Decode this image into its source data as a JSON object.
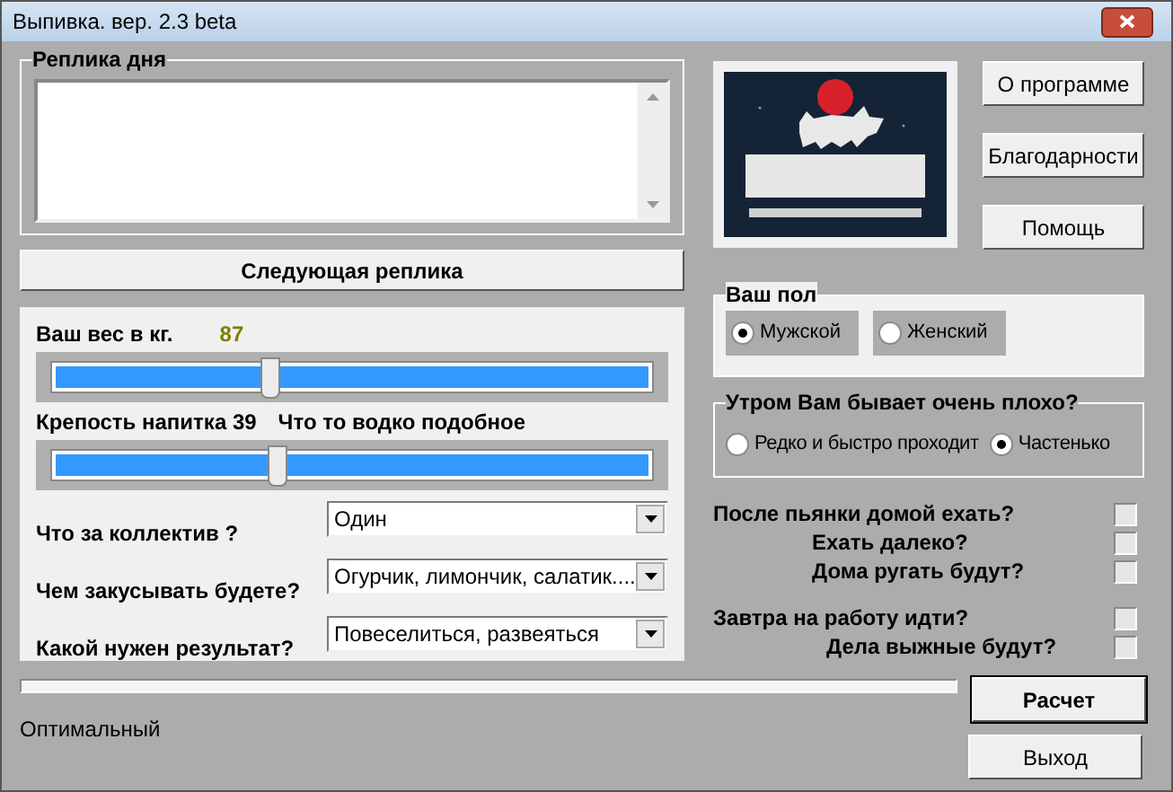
{
  "window": {
    "title": "Выпивка. вер. 2.3 beta"
  },
  "phrase": {
    "title": "Реплика дня"
  },
  "next_button": "Следующая реплика",
  "weight": {
    "label": "Ваш вес в кг.",
    "value": "87",
    "level": 0.37
  },
  "strength": {
    "label": "Крепость напитка 39",
    "description": "Что то водко подобное",
    "level": 0.38
  },
  "combos": [
    {
      "label": "Что за коллектив ?",
      "value": "Один"
    },
    {
      "label": "Чем закусывать будете?",
      "value": "Огурчик, лимончик, салатик....."
    },
    {
      "label": "Какой нужен результат?",
      "value": "Повеселиться, развеяться"
    }
  ],
  "logo": {
    "kind": "picture"
  },
  "side_buttons": [
    "О программе",
    "Благодарности",
    "Помощь"
  ],
  "gender": {
    "title": "Ваш пол",
    "options": [
      {
        "label": "Мужской",
        "selected": true
      },
      {
        "label": "Женский",
        "selected": false
      }
    ]
  },
  "morning": {
    "title": "Утром Вам бывает очень плохо?",
    "options": [
      {
        "label": "Редко и быстро проходит",
        "selected": false
      },
      {
        "label": "Частенько",
        "selected": true
      }
    ]
  },
  "checks": [
    [
      {
        "label": "После пьянки домой ехать?",
        "checked": false
      },
      {
        "label": "Ехать далеко?",
        "checked": false
      },
      {
        "label": "Дома ругать будут?",
        "checked": false
      }
    ],
    [
      {
        "label": "Завтра на работу идти?",
        "checked": false
      },
      {
        "label": "Дела выжные будут?",
        "checked": false
      }
    ]
  ],
  "progress": {
    "level": 0
  },
  "result": "Оптимальный",
  "calc_button": "Расчет",
  "exit_button": "Выход"
}
